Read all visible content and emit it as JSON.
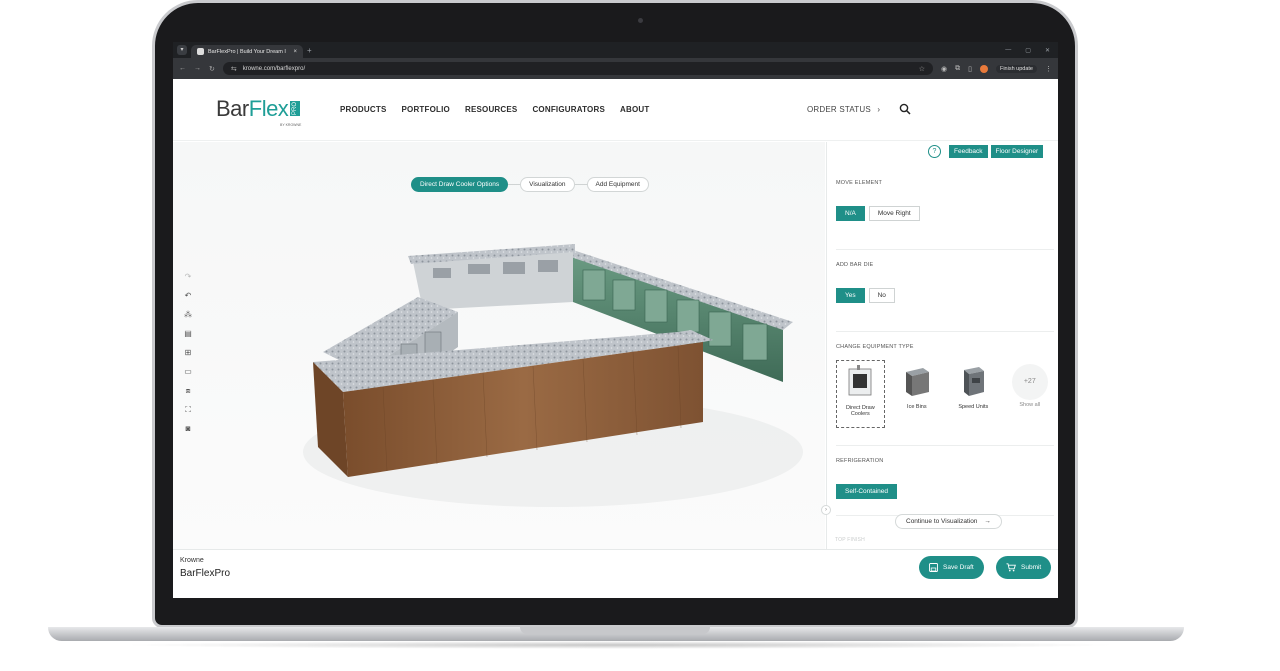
{
  "browser": {
    "tab_title": "BarFlexPro | Build Your Dream I",
    "tab_close": "×",
    "new_tab": "+",
    "url": "krowne.com/barflexpro/",
    "finish_update": "Finish update"
  },
  "header": {
    "logo_bar": "Bar",
    "logo_flex": "Flex",
    "logo_pro": "PRO",
    "logo_by": "BY KROWNE",
    "nav": [
      "PRODUCTS",
      "PORTFOLIO",
      "RESOURCES",
      "CONFIGURATORS",
      "ABOUT"
    ],
    "order_status": "ORDER STATUS",
    "order_chevron": "›"
  },
  "steps": [
    "Direct Draw Cooler Options",
    "Visualization",
    "Add Equipment"
  ],
  "panel": {
    "help": "?",
    "feedback": "Feedback",
    "floor_designer": "Floor Designer",
    "move_element": {
      "title": "MOVE ELEMENT",
      "options": [
        "N/A",
        "Move Right"
      ],
      "selected": "N/A"
    },
    "add_bar_die": {
      "title": "ADD BAR DIE",
      "options": [
        "Yes",
        "No"
      ],
      "selected": "Yes"
    },
    "equipment_type": {
      "title": "CHANGE EQUIPMENT TYPE",
      "items": [
        "Direct Draw Coolers",
        "Ice Bins",
        "Speed Units"
      ],
      "selected": "Direct Draw Coolers",
      "more_count": "+27",
      "more_label": "Show all"
    },
    "refrigeration": {
      "title": "REFRIGERATION",
      "selected": "Self-Contained"
    },
    "continue": "Continue to Visualization",
    "next_section": "TOP FINISH"
  },
  "footer": {
    "brand": "Krowne",
    "product": "BarFlexPro",
    "save_draft": "Save Draft",
    "submit": "Submit"
  },
  "colors": {
    "accent": "#1f8f88",
    "wood": "#8a5a36",
    "granite": "#b9bfc6",
    "cooler_green": "#5b8a73"
  }
}
